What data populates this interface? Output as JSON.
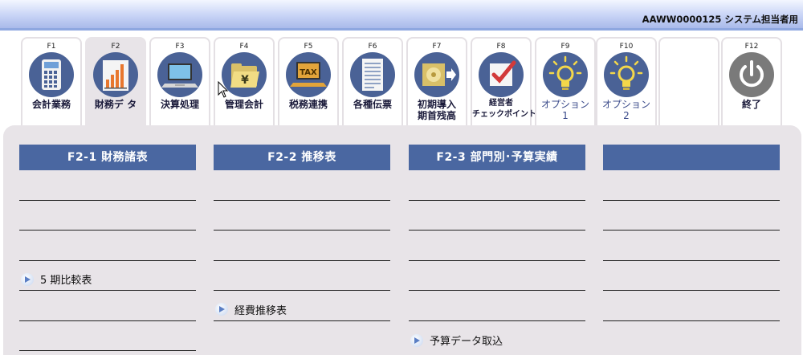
{
  "header": {
    "system_user": "AAWW0000125 システム担当者用"
  },
  "fkeys": [
    {
      "key": "F1",
      "label": "会計業務",
      "icon": "calculator-icon"
    },
    {
      "key": "F2",
      "label": "財務デ タ",
      "icon": "bar-chart-icon",
      "active": true
    },
    {
      "key": "F3",
      "label": "決算処理",
      "icon": "laptop-icon"
    },
    {
      "key": "F4",
      "label": "管理会計",
      "icon": "yen-folder-icon"
    },
    {
      "key": "F5",
      "label": "税務連携",
      "icon": "tax-laptop-icon"
    },
    {
      "key": "F6",
      "label": "各種伝票",
      "icon": "document-icon"
    },
    {
      "key": "F7",
      "label": "初期導入",
      "label2": "期首残高",
      "icon": "disk-import-icon"
    },
    {
      "key": "F8",
      "label": "経営者",
      "label2": "チェックポイント",
      "icon": "checkbox-icon"
    },
    {
      "key": "F9",
      "label": "オプション",
      "sub": "1",
      "icon": "lightbulb-icon"
    },
    {
      "key": "F10",
      "label": "オプション",
      "sub": "2",
      "icon": "lightbulb-icon"
    },
    {
      "key": "",
      "label": "",
      "icon": ""
    },
    {
      "key": "F12",
      "label": "終了",
      "icon": "power-icon"
    }
  ],
  "columns": [
    {
      "title": "F2-1 財務諸表",
      "rows": [
        "",
        "",
        "",
        "5 期比較表",
        "",
        ""
      ]
    },
    {
      "title": "F2-2 推移表",
      "rows": [
        "",
        "",
        "",
        "",
        "経費推移表",
        ""
      ]
    },
    {
      "title": "F2-3 部門別･予算実績",
      "rows": [
        "",
        "",
        "",
        "",
        "",
        "予算データ取込"
      ]
    },
    {
      "title": "",
      "rows": [
        "",
        "",
        "",
        "",
        "",
        ""
      ]
    }
  ]
}
